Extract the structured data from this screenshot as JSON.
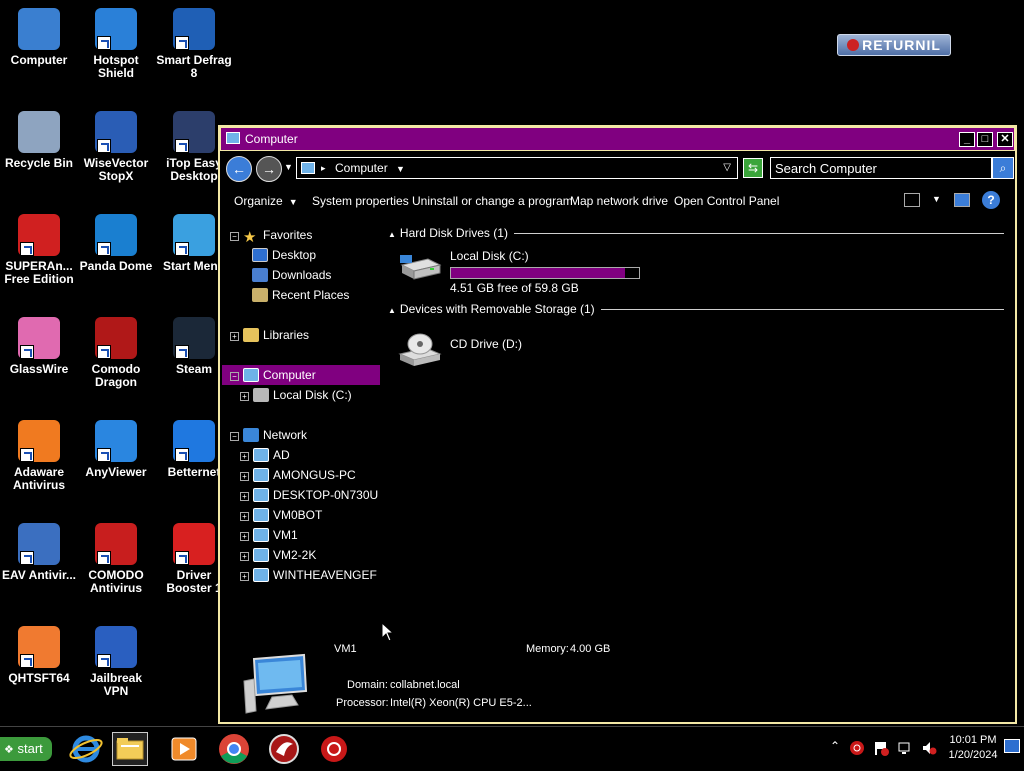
{
  "desktop": {
    "icons": [
      {
        "label": "Computer",
        "icon": "computer-icon",
        "color": "#3a7fd0"
      },
      {
        "label": "Hotspot Shield",
        "icon": "hotspot-shield-icon",
        "color": "#2a80d8"
      },
      {
        "label": "Smart Defrag 8",
        "icon": "smart-defrag-icon",
        "color": "#1f5fb5"
      },
      {
        "label": "Recycle Bin",
        "icon": "recycle-bin-icon",
        "color": "#8ea4c0"
      },
      {
        "label": "WiseVector StopX",
        "icon": "wisevector-icon",
        "color": "#2a5db5"
      },
      {
        "label": "iTop Easy Desktop",
        "icon": "itop-icon",
        "color": "#2c3e6b"
      },
      {
        "label": "SUPERAn... Free Edition",
        "icon": "superantispyware-icon",
        "color": "#d02020"
      },
      {
        "label": "Panda Dome",
        "icon": "panda-dome-icon",
        "color": "#1a7fd0"
      },
      {
        "label": "Start Menu",
        "icon": "start-menu-icon",
        "color": "#3aa0e0"
      },
      {
        "label": "GlassWire",
        "icon": "glasswire-icon",
        "color": "#e06ab0"
      },
      {
        "label": "Comodo Dragon",
        "icon": "comodo-dragon-icon",
        "color": "#b01818"
      },
      {
        "label": "Steam",
        "icon": "steam-icon",
        "color": "#1b2838"
      },
      {
        "label": "Adaware Antivirus",
        "icon": "adaware-icon",
        "color": "#f07a20"
      },
      {
        "label": "AnyViewer",
        "icon": "anyviewer-icon",
        "color": "#2a86e0"
      },
      {
        "label": "Betternet",
        "icon": "betternet-icon",
        "color": "#1f78e0"
      },
      {
        "label": "EAV Antivir...",
        "icon": "eav-antivirus-icon",
        "color": "#3b6fc0"
      },
      {
        "label": "COMODO Antivirus",
        "icon": "comodo-antivirus-icon",
        "color": "#c81e1e"
      },
      {
        "label": "Driver Booster 1",
        "icon": "driver-booster-icon",
        "color": "#d82020"
      },
      {
        "label": "QHTSFT64",
        "icon": "qhtsft-icon",
        "color": "#f07a30"
      },
      {
        "label": "Jailbreak VPN",
        "icon": "jailbreak-vpn-icon",
        "color": "#2a5fc0"
      }
    ],
    "returnil_label": "RETURNIL"
  },
  "window": {
    "title": "Computer",
    "address": "Computer",
    "search_placeholder": "Search Computer",
    "toolbar": {
      "organize": "Organize",
      "system_properties": "System properties",
      "uninstall": "Uninstall or change a program",
      "map_drive": "Map network drive",
      "control_panel": "Open Control Panel"
    },
    "nav": {
      "favorites": "Favorites",
      "desktop": "Desktop",
      "downloads": "Downloads",
      "recent": "Recent Places",
      "libraries": "Libraries",
      "computer": "Computer",
      "local_disk": "Local Disk (C:)",
      "network": "Network",
      "network_items": [
        "AD",
        "AMONGUS-PC",
        "DESKTOP-0N730U",
        "VM0BOT",
        "VM1",
        "VM2-2K",
        "WINTHEAVENGEF"
      ]
    },
    "content": {
      "hdd_group": "Hard Disk Drives (1)",
      "removable_group": "Devices with Removable Storage (1)",
      "c_drive_name": "Local Disk (C:)",
      "c_drive_free": "4.51 GB free of 59.8 GB",
      "c_drive_used_fraction": 0.925,
      "d_drive_name": "CD Drive (D:)"
    },
    "details": {
      "name": "VM1",
      "memory_label": "Memory:",
      "memory_value": "4.00 GB",
      "domain_label": "Domain:",
      "domain_value": "collabnet.local",
      "processor_label": "Processor:",
      "processor_value": "Intel(R) Xeon(R) CPU E5-2..."
    }
  },
  "taskbar": {
    "start": "start",
    "time": "10:01 PM",
    "date": "1/20/2024"
  },
  "colors": {
    "accent": "#800080",
    "window_border": "#f3e8a6"
  }
}
